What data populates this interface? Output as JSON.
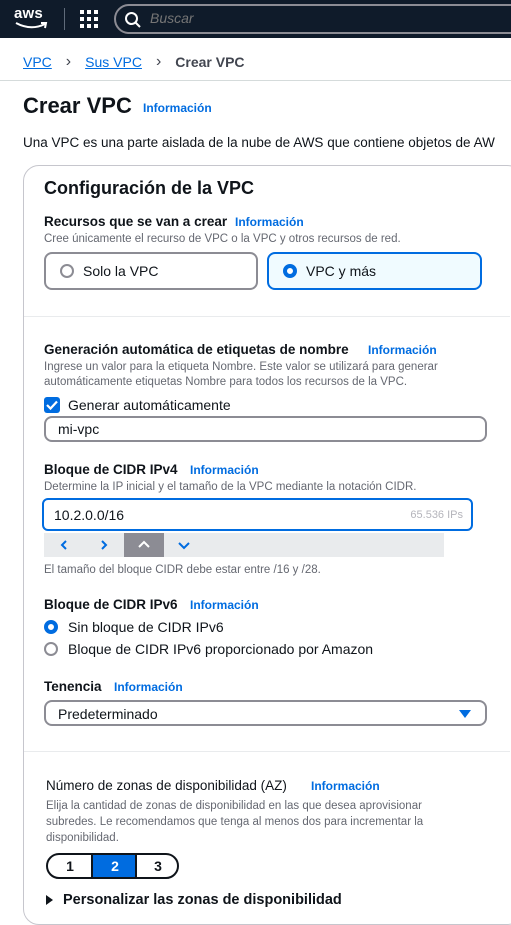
{
  "topnav": {
    "logo_text": "aws",
    "search_placeholder": "Buscar"
  },
  "breadcrumb": {
    "items": [
      "VPC",
      "Sus VPC"
    ],
    "current": "Crear VPC"
  },
  "page": {
    "title": "Crear VPC",
    "info_label": "Información",
    "description": "Una VPC es una parte aislada de la nube de AWS que contiene objetos de AW"
  },
  "panel": {
    "title": "Configuración de la VPC",
    "resources": {
      "label": "Recursos que se van a crear",
      "info": "Información",
      "hint": "Cree únicamente el recurso de VPC o la VPC y otros recursos de red.",
      "options": [
        "Solo la VPC",
        "VPC y más"
      ],
      "selected": "VPC y más"
    },
    "name_tag": {
      "label": "Generación automática de etiquetas de nombre",
      "info": "Información",
      "hint_line1": "Ingrese un valor para la etiqueta Nombre. Este valor se utilizará para generar",
      "hint_line2": "automáticamente etiquetas Nombre para todos los recursos de la VPC.",
      "checkbox_label": "Generar automáticamente",
      "checked": true,
      "value": "mi-vpc"
    },
    "ipv4": {
      "label": "Bloque de CIDR IPv4",
      "info": "Información",
      "hint": "Determine la IP inicial y el tamaño de la VPC mediante la notación CIDR.",
      "value": "10.2.0.0/16",
      "ip_count": "65.536 IPs",
      "constraint": "El tamaño del bloque CIDR debe estar entre /16 y /28."
    },
    "ipv6": {
      "label": "Bloque de CIDR IPv6",
      "info": "Información",
      "options": [
        "Sin bloque de CIDR IPv6",
        "Bloque de CIDR IPv6 proporcionado por Amazon"
      ],
      "selected": "Sin bloque de CIDR IPv6"
    },
    "tenancy": {
      "label": "Tenencia",
      "info": "Información",
      "value": "Predeterminado"
    },
    "az": {
      "label": "Número de zonas de disponibilidad (AZ)",
      "info": "Información",
      "hint_line1": "Elija la cantidad de zonas de disponibilidad en las que desea aprovisionar",
      "hint_line2": "subredes. Le recomendamos que tenga al menos dos para incrementar la",
      "hint_line3": "disponibilidad.",
      "options": [
        "1",
        "2",
        "3"
      ],
      "selected": "2",
      "customize_label": "Personalizar las zonas de disponibilidad"
    }
  },
  "colors": {
    "nav_bg": "#0f1b2a",
    "accent": "#006ce0",
    "text": "#0f141a",
    "hint": "#656871"
  }
}
